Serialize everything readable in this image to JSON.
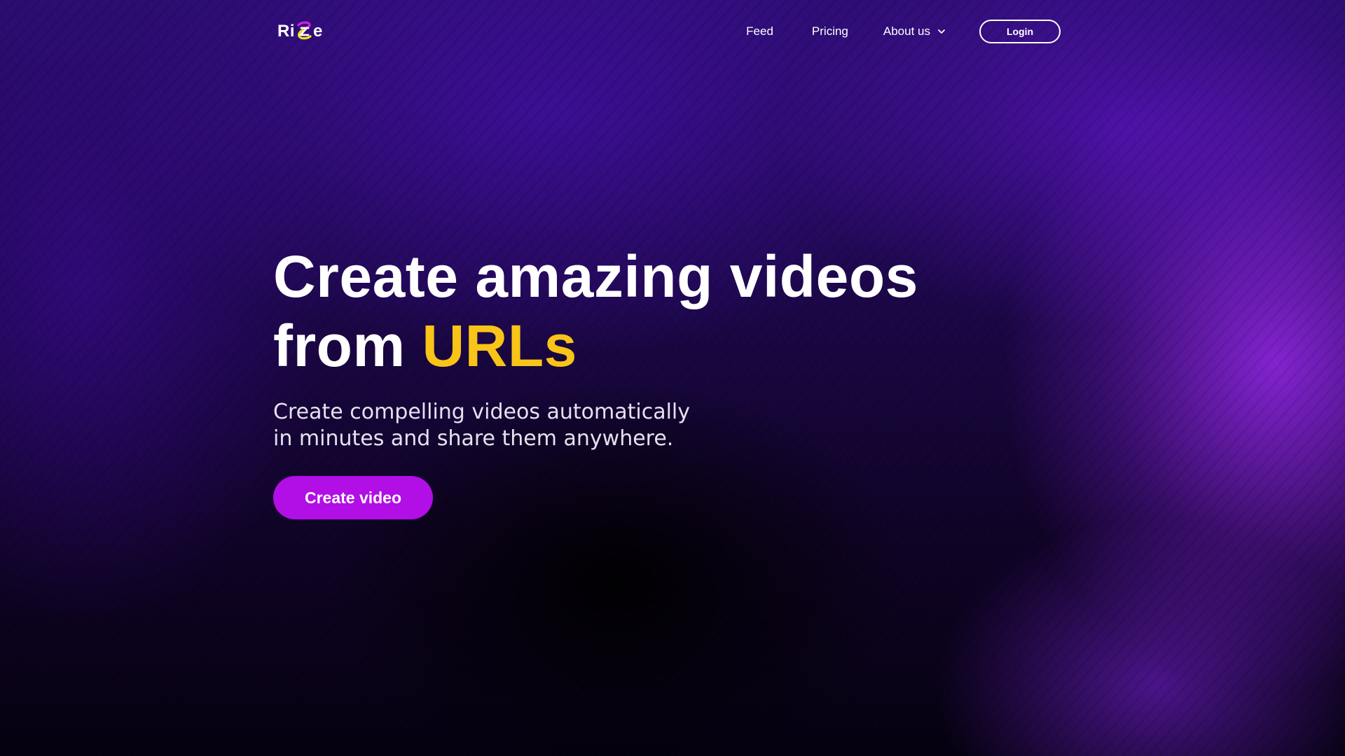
{
  "header": {
    "logo": {
      "text_left": "Ri",
      "text_right": "e",
      "mark_icon": "rizzle-z-swirl-icon",
      "mark_colors": [
        "#d61fe0",
        "#f1e01a"
      ]
    },
    "nav": {
      "feed_label": "Feed",
      "pricing_label": "Pricing",
      "about_label": "About us",
      "about_icon": "chevron-down-icon",
      "login_label": "Login"
    }
  },
  "hero": {
    "title_line1": "Create amazing videos",
    "title_line2_prefix": "from ",
    "title_line2_accent": "URLs",
    "subtitle_line1": "Create compelling videos automatically",
    "subtitle_line2": "in minutes and share them anywhere.",
    "cta_label": "Create video"
  },
  "colors": {
    "accent_yellow": "#f9c418",
    "cta_purple": "#b20ee6",
    "background_deep": "#1b0747"
  }
}
